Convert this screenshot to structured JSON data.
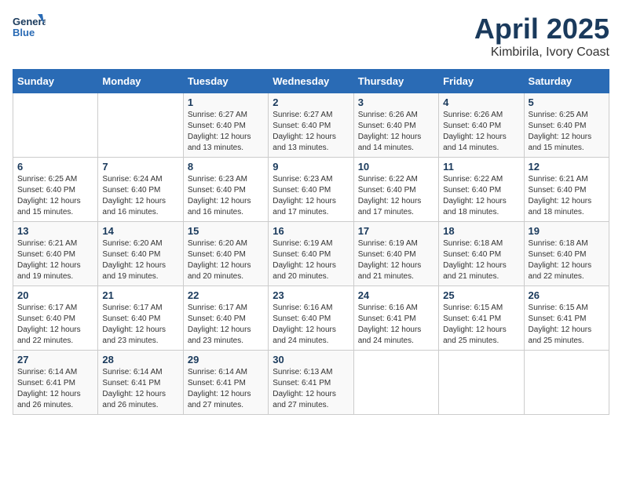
{
  "header": {
    "logo_line1": "General",
    "logo_line2": "Blue",
    "month": "April 2025",
    "location": "Kimbirila, Ivory Coast"
  },
  "days_of_week": [
    "Sunday",
    "Monday",
    "Tuesday",
    "Wednesday",
    "Thursday",
    "Friday",
    "Saturday"
  ],
  "weeks": [
    [
      null,
      null,
      {
        "day": "1",
        "sunrise": "6:27 AM",
        "sunset": "6:40 PM",
        "daylight": "12 hours and 13 minutes."
      },
      {
        "day": "2",
        "sunrise": "6:27 AM",
        "sunset": "6:40 PM",
        "daylight": "12 hours and 13 minutes."
      },
      {
        "day": "3",
        "sunrise": "6:26 AM",
        "sunset": "6:40 PM",
        "daylight": "12 hours and 14 minutes."
      },
      {
        "day": "4",
        "sunrise": "6:26 AM",
        "sunset": "6:40 PM",
        "daylight": "12 hours and 14 minutes."
      },
      {
        "day": "5",
        "sunrise": "6:25 AM",
        "sunset": "6:40 PM",
        "daylight": "12 hours and 15 minutes."
      }
    ],
    [
      {
        "day": "6",
        "sunrise": "6:25 AM",
        "sunset": "6:40 PM",
        "daylight": "12 hours and 15 minutes."
      },
      {
        "day": "7",
        "sunrise": "6:24 AM",
        "sunset": "6:40 PM",
        "daylight": "12 hours and 16 minutes."
      },
      {
        "day": "8",
        "sunrise": "6:23 AM",
        "sunset": "6:40 PM",
        "daylight": "12 hours and 16 minutes."
      },
      {
        "day": "9",
        "sunrise": "6:23 AM",
        "sunset": "6:40 PM",
        "daylight": "12 hours and 17 minutes."
      },
      {
        "day": "10",
        "sunrise": "6:22 AM",
        "sunset": "6:40 PM",
        "daylight": "12 hours and 17 minutes."
      },
      {
        "day": "11",
        "sunrise": "6:22 AM",
        "sunset": "6:40 PM",
        "daylight": "12 hours and 18 minutes."
      },
      {
        "day": "12",
        "sunrise": "6:21 AM",
        "sunset": "6:40 PM",
        "daylight": "12 hours and 18 minutes."
      }
    ],
    [
      {
        "day": "13",
        "sunrise": "6:21 AM",
        "sunset": "6:40 PM",
        "daylight": "12 hours and 19 minutes."
      },
      {
        "day": "14",
        "sunrise": "6:20 AM",
        "sunset": "6:40 PM",
        "daylight": "12 hours and 19 minutes."
      },
      {
        "day": "15",
        "sunrise": "6:20 AM",
        "sunset": "6:40 PM",
        "daylight": "12 hours and 20 minutes."
      },
      {
        "day": "16",
        "sunrise": "6:19 AM",
        "sunset": "6:40 PM",
        "daylight": "12 hours and 20 minutes."
      },
      {
        "day": "17",
        "sunrise": "6:19 AM",
        "sunset": "6:40 PM",
        "daylight": "12 hours and 21 minutes."
      },
      {
        "day": "18",
        "sunrise": "6:18 AM",
        "sunset": "6:40 PM",
        "daylight": "12 hours and 21 minutes."
      },
      {
        "day": "19",
        "sunrise": "6:18 AM",
        "sunset": "6:40 PM",
        "daylight": "12 hours and 22 minutes."
      }
    ],
    [
      {
        "day": "20",
        "sunrise": "6:17 AM",
        "sunset": "6:40 PM",
        "daylight": "12 hours and 22 minutes."
      },
      {
        "day": "21",
        "sunrise": "6:17 AM",
        "sunset": "6:40 PM",
        "daylight": "12 hours and 23 minutes."
      },
      {
        "day": "22",
        "sunrise": "6:17 AM",
        "sunset": "6:40 PM",
        "daylight": "12 hours and 23 minutes."
      },
      {
        "day": "23",
        "sunrise": "6:16 AM",
        "sunset": "6:40 PM",
        "daylight": "12 hours and 24 minutes."
      },
      {
        "day": "24",
        "sunrise": "6:16 AM",
        "sunset": "6:41 PM",
        "daylight": "12 hours and 24 minutes."
      },
      {
        "day": "25",
        "sunrise": "6:15 AM",
        "sunset": "6:41 PM",
        "daylight": "12 hours and 25 minutes."
      },
      {
        "day": "26",
        "sunrise": "6:15 AM",
        "sunset": "6:41 PM",
        "daylight": "12 hours and 25 minutes."
      }
    ],
    [
      {
        "day": "27",
        "sunrise": "6:14 AM",
        "sunset": "6:41 PM",
        "daylight": "12 hours and 26 minutes."
      },
      {
        "day": "28",
        "sunrise": "6:14 AM",
        "sunset": "6:41 PM",
        "daylight": "12 hours and 26 minutes."
      },
      {
        "day": "29",
        "sunrise": "6:14 AM",
        "sunset": "6:41 PM",
        "daylight": "12 hours and 27 minutes."
      },
      {
        "day": "30",
        "sunrise": "6:13 AM",
        "sunset": "6:41 PM",
        "daylight": "12 hours and 27 minutes."
      },
      null,
      null,
      null
    ]
  ]
}
